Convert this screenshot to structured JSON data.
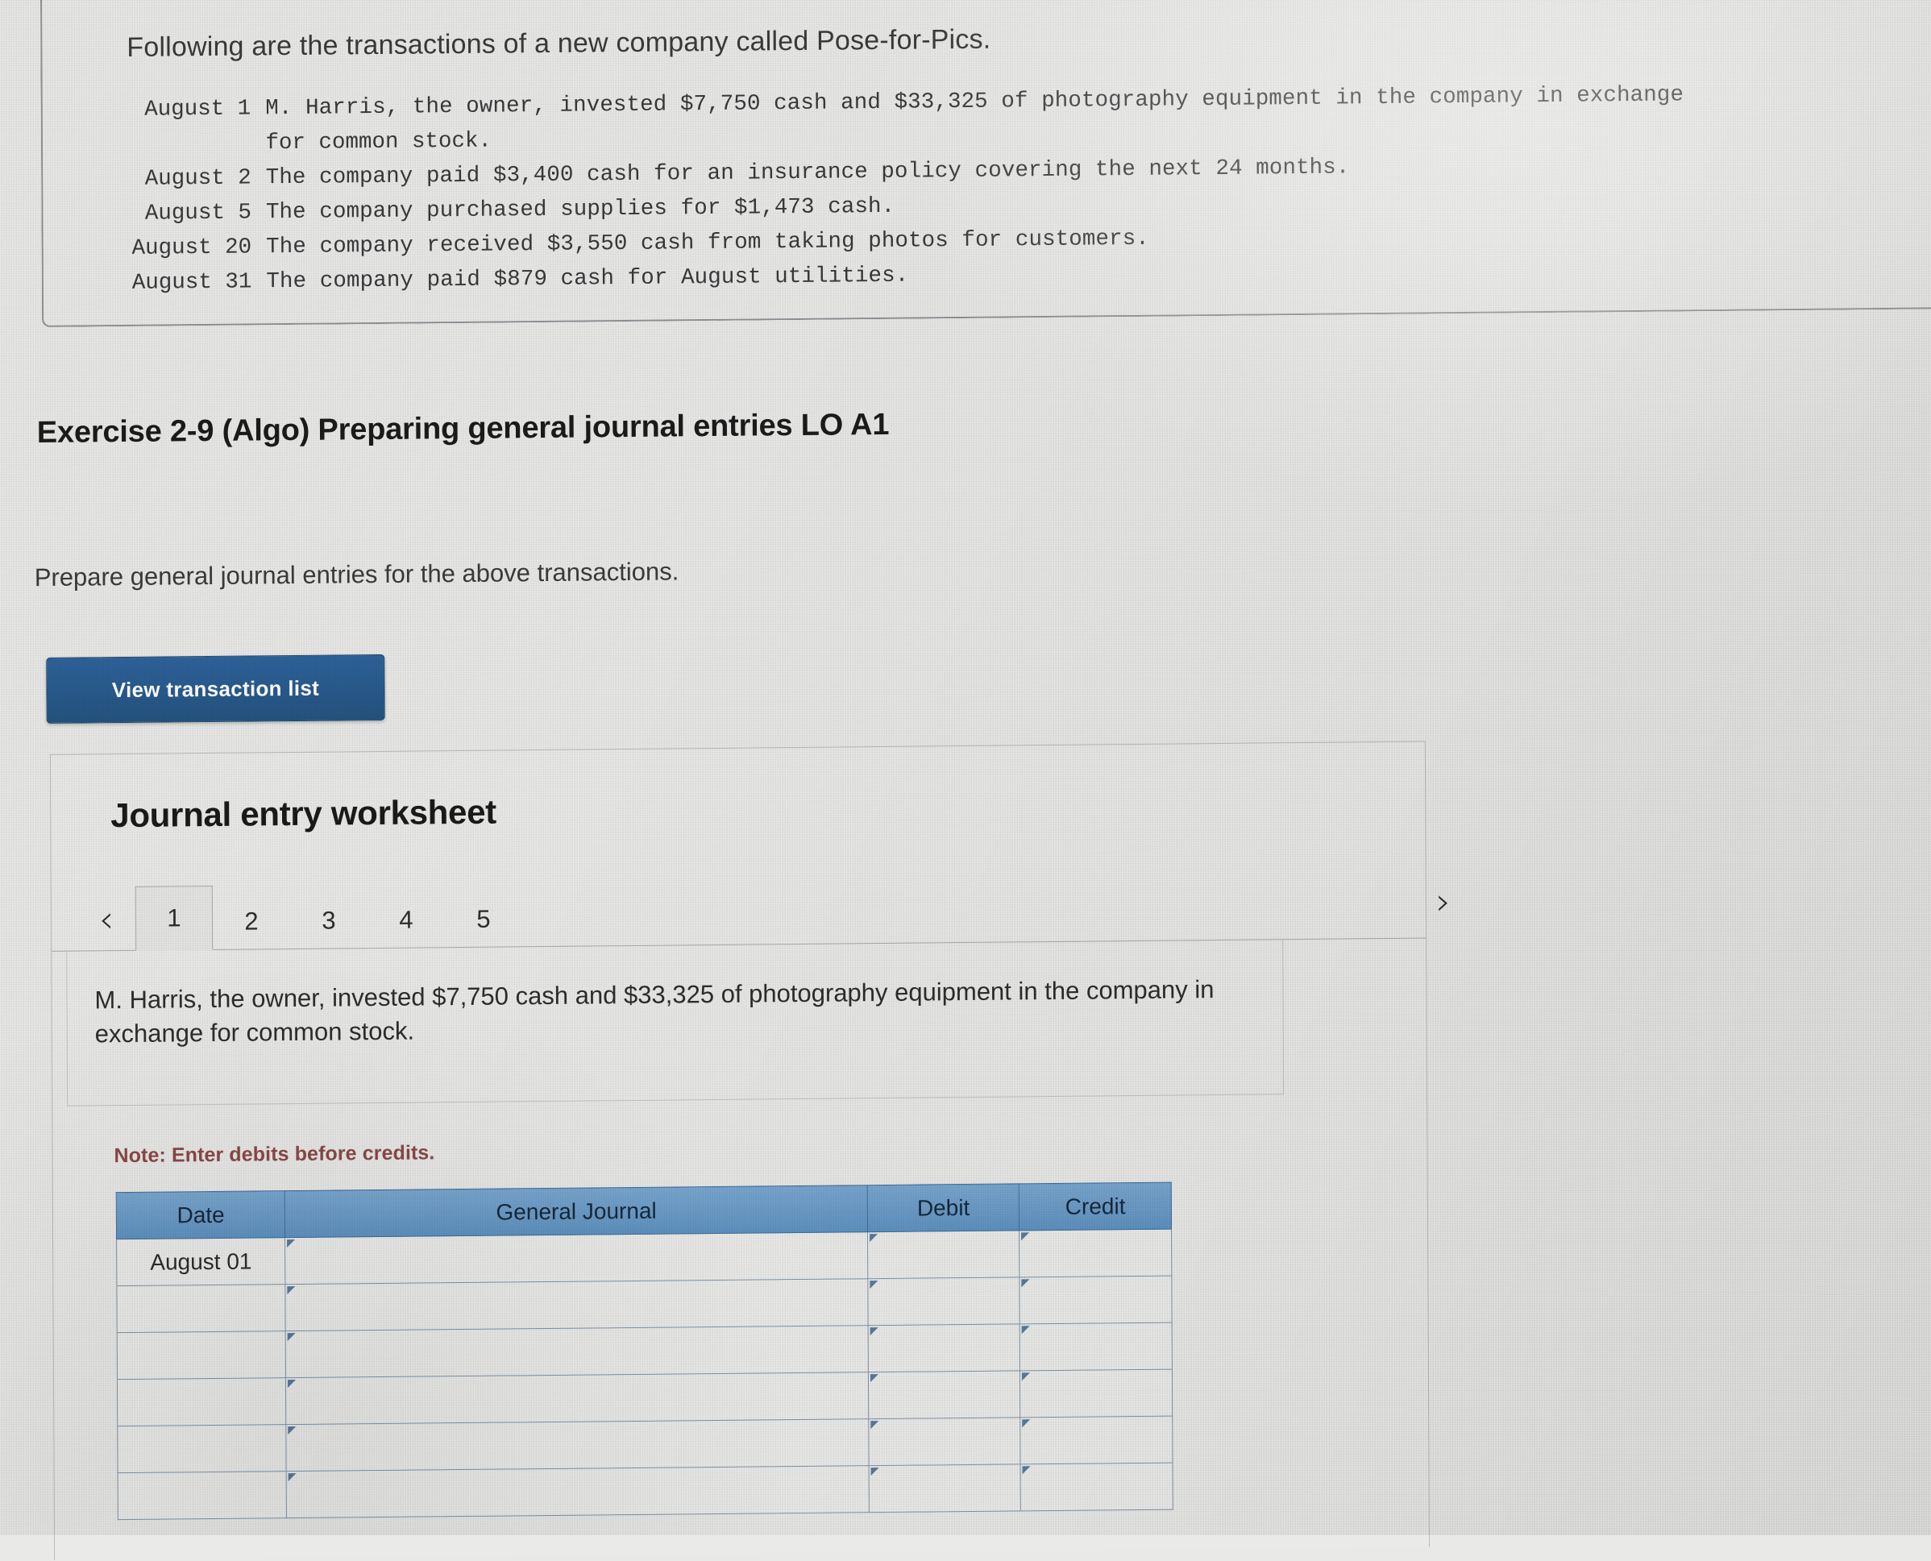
{
  "transaction_panel": {
    "intro": "Following are the transactions of a new company called Pose-for-Pics.",
    "rows": [
      {
        "date": "August 1",
        "desc": "M. Harris, the owner, invested $7,750 cash and $33,325 of photography equipment in the company in exchange",
        "cont": "for common stock."
      },
      {
        "date": "August 2",
        "desc": "The company paid $3,400 cash for an insurance policy covering the next 24 months.",
        "cont": ""
      },
      {
        "date": "August 5",
        "desc": "The company purchased supplies for $1,473 cash.",
        "cont": ""
      },
      {
        "date": "August 20",
        "desc": "The company received $3,550 cash from taking photos for customers.",
        "cont": ""
      },
      {
        "date": "August 31",
        "desc": "The company paid $879 cash for August utilities.",
        "cont": ""
      }
    ]
  },
  "exercise": {
    "title": "Exercise 2-9 (Algo) Preparing general journal entries LO A1",
    "prompt": "Prepare general journal entries for the above transactions."
  },
  "buttons": {
    "view_transaction_list": "View transaction list"
  },
  "worksheet": {
    "title": "Journal entry worksheet",
    "prev_icon": "‹",
    "next_icon": "›",
    "tabs": [
      "1",
      "2",
      "3",
      "4",
      "5"
    ],
    "active_tab": "1",
    "description": "M. Harris, the owner, invested $7,750 cash and $33,325 of photography equipment in the company in exchange for common stock.",
    "note": "Note: Enter debits before credits.",
    "table": {
      "headers": [
        "Date",
        "General Journal",
        "Debit",
        "Credit"
      ],
      "rows": [
        {
          "date": "August 01",
          "general_journal": "",
          "debit": "",
          "credit": ""
        },
        {
          "date": "",
          "general_journal": "",
          "debit": "",
          "credit": ""
        },
        {
          "date": "",
          "general_journal": "",
          "debit": "",
          "credit": ""
        },
        {
          "date": "",
          "general_journal": "",
          "debit": "",
          "credit": ""
        },
        {
          "date": "",
          "general_journal": "",
          "debit": "",
          "credit": ""
        },
        {
          "date": "",
          "general_journal": "",
          "debit": "",
          "credit": ""
        }
      ]
    }
  },
  "colors": {
    "button_blue": "#2a5d96",
    "table_header_blue": "#6e9ec9",
    "note_red": "#8b4a48",
    "page_bg": "#e9e9e7"
  }
}
